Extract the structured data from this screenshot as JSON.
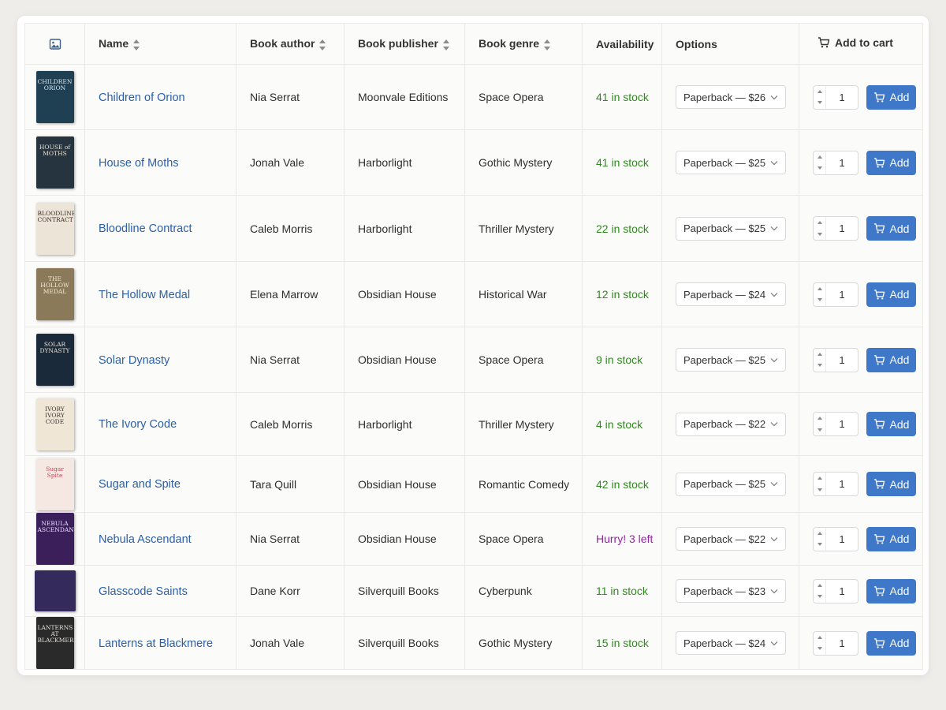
{
  "headers": {
    "image_icon": "image-icon",
    "name": "Name",
    "author": "Book author",
    "publisher": "Book publisher",
    "genre": "Book genre",
    "availability": "Availability",
    "options": "Options",
    "cart": "Add to cart"
  },
  "add_label": "Add",
  "books": [
    {
      "name": "Children of Orion",
      "author": "Nia Serrat",
      "publisher": "Moonvale Editions",
      "genre": "Space Opera",
      "availability": "41 in stock",
      "low": false,
      "option": "Paperback — $26",
      "qty": "1",
      "cover": {
        "title": "CHILDREN ORION",
        "bg": "#1f3f52",
        "fg": "#dfe8ee"
      }
    },
    {
      "name": "House of Moths",
      "author": "Jonah Vale",
      "publisher": "Harborlight",
      "genre": "Gothic Mystery",
      "availability": "41 in stock",
      "low": false,
      "option": "Paperback — $25",
      "qty": "1",
      "cover": {
        "title": "HOUSE of MOTHS",
        "bg": "#263440",
        "fg": "#e6e1d4"
      }
    },
    {
      "name": "Bloodline Contract",
      "author": "Caleb Morris",
      "publisher": "Harborlight",
      "genre": "Thriller Mystery",
      "availability": "22 in stock",
      "low": false,
      "option": "Paperback — $25",
      "qty": "1",
      "cover": {
        "title": "BLOODLINE CONTRACT",
        "bg": "#ece4d6",
        "fg": "#3a2a24"
      }
    },
    {
      "name": "The Hollow Medal",
      "author": "Elena Marrow",
      "publisher": "Obsidian House",
      "genre": "Historical War",
      "availability": "12 in stock",
      "low": false,
      "option": "Paperback — $24",
      "qty": "1",
      "cover": {
        "title": "THE HOLLOW MEDAL",
        "bg": "#8a7a5a",
        "fg": "#f1e9d4"
      }
    },
    {
      "name": "Solar Dynasty",
      "author": "Nia Serrat",
      "publisher": "Obsidian House",
      "genre": "Space Opera",
      "availability": "9 in stock",
      "low": false,
      "option": "Paperback — $25",
      "qty": "1",
      "cover": {
        "title": "SOLAR DYNASTY",
        "bg": "#1b2a3a",
        "fg": "#e9e4d8"
      }
    },
    {
      "name": "The Ivory Code",
      "author": "Caleb Morris",
      "publisher": "Harborlight",
      "genre": "Thriller Mystery",
      "availability": "4 in stock",
      "low": false,
      "option": "Paperback — $22",
      "qty": "1",
      "cover": {
        "title": "IVORY IVORY CODE",
        "bg": "#efe6d6",
        "fg": "#3b3430"
      }
    },
    {
      "name": "Sugar and Spite",
      "author": "Tara Quill",
      "publisher": "Obsidian House",
      "genre": "Romantic Comedy",
      "availability": "42 in stock",
      "low": false,
      "option": "Paperback — $25",
      "qty": "1",
      "cover": {
        "title": "Sugar Spite",
        "bg": "#f5e8e2",
        "fg": "#c4485a"
      }
    },
    {
      "name": "Nebula Ascendant",
      "author": "Nia Serrat",
      "publisher": "Obsidian House",
      "genre": "Space Opera",
      "availability": "Hurry! 3 left",
      "low": true,
      "option": "Paperback — $22",
      "qty": "1",
      "cover": {
        "title": "NEBULA ASCENDANT",
        "bg": "#3a1f5a",
        "fg": "#efe2ff"
      }
    },
    {
      "name": "Glasscode Saints",
      "author": "Dane Korr",
      "publisher": "Silverquill Books",
      "genre": "Cyberpunk",
      "availability": "11 in stock",
      "low": false,
      "option": "Paperback — $23",
      "qty": "1",
      "cover": {
        "title": "",
        "bg": "#352a5c",
        "fg": "#f3d4ff",
        "square": true
      }
    },
    {
      "name": "Lanterns at Blackmere",
      "author": "Jonah Vale",
      "publisher": "Silverquill Books",
      "genre": "Gothic Mystery",
      "availability": "15 in stock",
      "low": false,
      "option": "Paperback — $24",
      "qty": "1",
      "cover": {
        "title": "LANTERNS AT BLACKMERE",
        "bg": "#2a2a2a",
        "fg": "#e5e1d8"
      }
    }
  ]
}
